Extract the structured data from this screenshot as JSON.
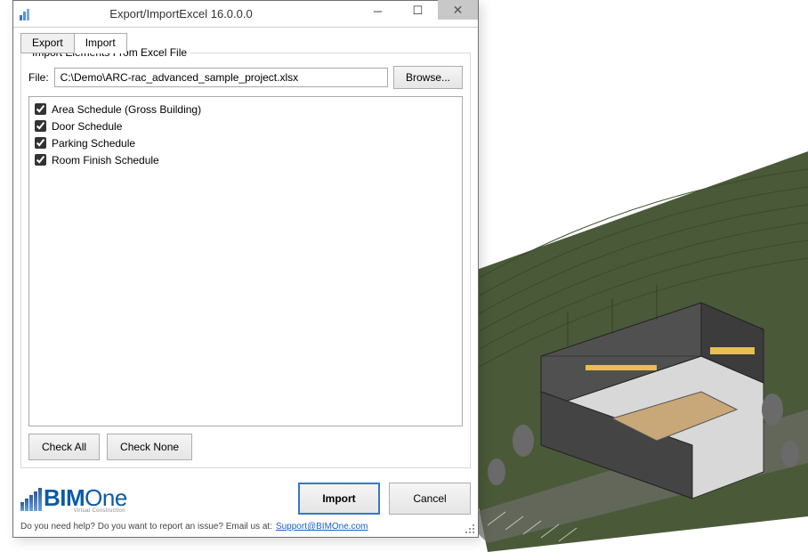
{
  "window": {
    "title": "Export/ImportExcel 16.0.0.0"
  },
  "tabs": [
    {
      "label": "Export",
      "active": false
    },
    {
      "label": "Import",
      "active": true
    }
  ],
  "group": {
    "title": "Import Elements From Excel File",
    "file_label": "File:",
    "file_path": "C:\\Demo\\ARC-rac_advanced_sample_project.xlsx",
    "browse_label": "Browse..."
  },
  "schedule_items": [
    {
      "label": "Area Schedule (Gross Building)",
      "checked": true
    },
    {
      "label": "Door Schedule",
      "checked": true
    },
    {
      "label": "Parking Schedule",
      "checked": true
    },
    {
      "label": "Room Finish Schedule",
      "checked": true
    }
  ],
  "buttons": {
    "check_all": "Check All",
    "check_none": "Check None",
    "import": "Import",
    "cancel": "Cancel"
  },
  "logo": {
    "bold": "BIM",
    "light": "One",
    "sub": "Virtual Construction"
  },
  "help": {
    "text": "Do you need help? Do you want to report an issue? Email us at:",
    "link": "Support@BIMOne.com"
  }
}
